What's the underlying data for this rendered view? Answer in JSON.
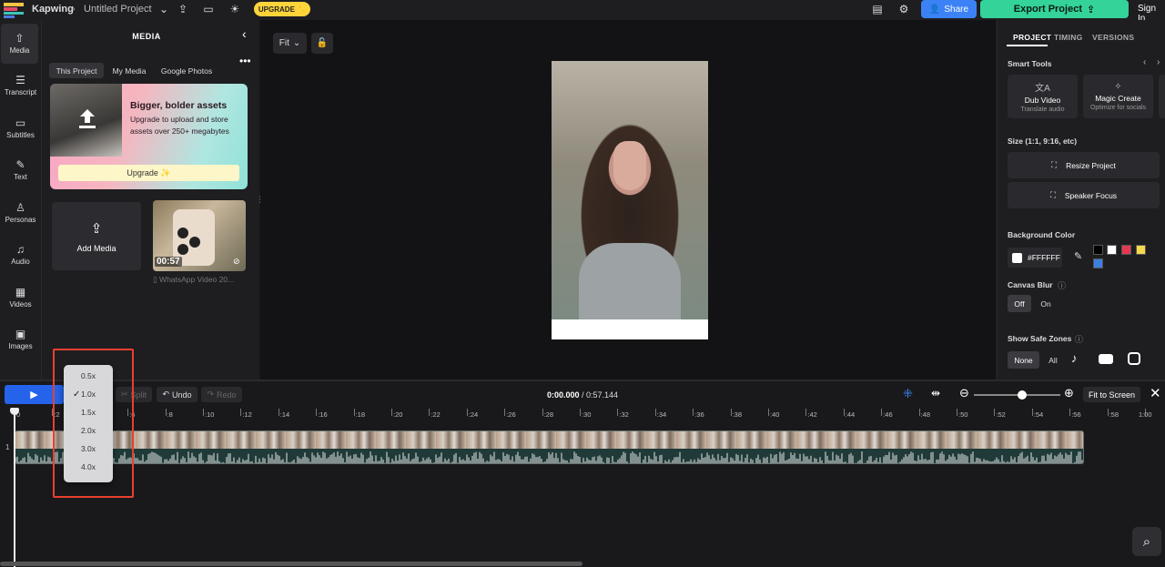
{
  "topbar": {
    "app_name": "Kapwing",
    "breadcrumb_sep": "›",
    "project_name": "Untitled Project",
    "upgrade_label": "UPGRADE ✨",
    "share_label": "Share",
    "export_label": "Export Project",
    "signin_label": "Sign In"
  },
  "rail": {
    "items": [
      {
        "label": "Media",
        "icon": "upload-cloud-icon"
      },
      {
        "label": "Transcript",
        "icon": "transcript-icon"
      },
      {
        "label": "Subtitles",
        "icon": "subtitles-icon"
      },
      {
        "label": "Text",
        "icon": "text-icon"
      },
      {
        "label": "Personas",
        "icon": "person-icon"
      },
      {
        "label": "Audio",
        "icon": "music-note-icon"
      },
      {
        "label": "Videos",
        "icon": "film-icon"
      },
      {
        "label": "Images",
        "icon": "image-icon"
      }
    ]
  },
  "media": {
    "title": "MEDIA",
    "tabs": [
      "This Project",
      "My Media",
      "Google Photos"
    ],
    "card_title": "Bigger, bolder assets",
    "card_body": "Upgrade to upload and store assets over 250+ megabytes",
    "card_button": "Upgrade ✨",
    "add_media_label": "Add Media",
    "video_duration": "00:57",
    "video_name": "WhatsApp Video 20..."
  },
  "canvas": {
    "fit_label": "Fit"
  },
  "right_panel": {
    "tabs": [
      "PROJECT",
      "TIMING",
      "VERSIONS"
    ],
    "smart_tools_label": "Smart Tools",
    "tools": [
      {
        "title": "Dub Video",
        "subtitle": "Translate audio"
      },
      {
        "title": "Magic Create",
        "subtitle": "Optimize for socials"
      }
    ],
    "size_label": "Size (1:1, 9:16, etc)",
    "resize_label": "Resize Project",
    "speaker_focus_label": "Speaker Focus",
    "bg_color_label": "Background Color",
    "bg_color_value": "#FFFFFF",
    "swatches": [
      "#000000",
      "#ffffff",
      "#e53950",
      "#f5d94a",
      "#3d7fe0"
    ],
    "canvas_blur_label": "Canvas Blur",
    "blur_options": [
      "Off",
      "On"
    ],
    "safe_zones_label": "Show Safe Zones",
    "safe_zone_options": [
      "None",
      "All"
    ]
  },
  "timeline": {
    "split_label": "Split",
    "undo_label": "Undo",
    "redo_label": "Redo",
    "current_time": "0:00.000",
    "total_time": "/ 0:57.144",
    "fit_screen_label": "Fit to Screen",
    "ticks": [
      "0",
      ":2",
      ":4",
      ":6",
      ":8",
      ":10",
      ":12",
      ":14",
      ":16",
      ":18",
      ":20",
      ":22",
      ":24",
      ":26",
      ":28",
      ":30",
      ":32",
      ":34",
      ":36",
      ":38",
      ":40",
      ":42",
      ":44",
      ":46",
      ":48",
      ":50",
      ":52",
      ":54",
      ":56",
      ":58",
      "1:00"
    ],
    "track_number": "1",
    "zoom_level": 0.52
  },
  "speed_menu": {
    "options": [
      "0.5x",
      "1.0x",
      "1.5x",
      "2.0x",
      "3.0x",
      "4.0x"
    ],
    "selected": "1.0x",
    "highlight_color": "#e8402f"
  },
  "colors": {
    "accent_blue": "#3b82f6",
    "export_green": "#34d399",
    "upgrade_yellow": "#ffd43b"
  }
}
